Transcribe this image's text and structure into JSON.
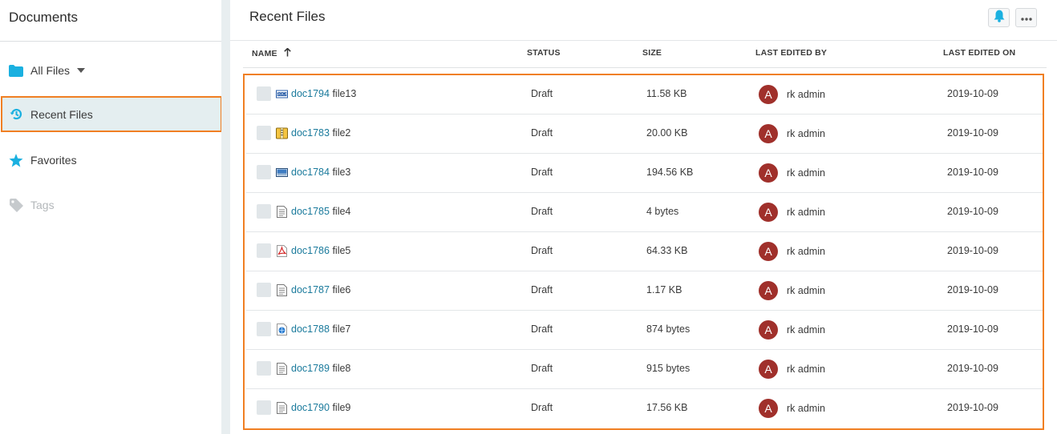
{
  "sidebar": {
    "title": "Documents",
    "items": [
      {
        "label": "All Files"
      },
      {
        "label": "Recent Files"
      },
      {
        "label": "Favorites"
      },
      {
        "label": "Tags"
      }
    ]
  },
  "header": {
    "title": "Recent Files"
  },
  "columns": {
    "name": "NAME",
    "status": "STATUS",
    "size": "SIZE",
    "last_edited_by": "LAST EDITED BY",
    "last_edited_on": "LAST EDITED ON"
  },
  "rows": [
    {
      "doc": "doc1794",
      "file": "file13",
      "icon": "docx-icon",
      "status": "Draft",
      "size": "11.58 KB",
      "avatar": "A",
      "editor": "rk admin",
      "date": "2019-10-09"
    },
    {
      "doc": "doc1783",
      "file": "file2",
      "icon": "archive-icon",
      "status": "Draft",
      "size": "20.00 KB",
      "avatar": "A",
      "editor": "rk admin",
      "date": "2019-10-09"
    },
    {
      "doc": "doc1784",
      "file": "file3",
      "icon": "image-icon",
      "status": "Draft",
      "size": "194.56 KB",
      "avatar": "A",
      "editor": "rk admin",
      "date": "2019-10-09"
    },
    {
      "doc": "doc1785",
      "file": "file4",
      "icon": "text-file-icon",
      "status": "Draft",
      "size": "4 bytes",
      "avatar": "A",
      "editor": "rk admin",
      "date": "2019-10-09"
    },
    {
      "doc": "doc1786",
      "file": "file5",
      "icon": "pdf-icon",
      "status": "Draft",
      "size": "64.33 KB",
      "avatar": "A",
      "editor": "rk admin",
      "date": "2019-10-09"
    },
    {
      "doc": "doc1787",
      "file": "file6",
      "icon": "text-file-icon",
      "status": "Draft",
      "size": "1.17 KB",
      "avatar": "A",
      "editor": "rk admin",
      "date": "2019-10-09"
    },
    {
      "doc": "doc1788",
      "file": "file7",
      "icon": "web-file-icon",
      "status": "Draft",
      "size": "874 bytes",
      "avatar": "A",
      "editor": "rk admin",
      "date": "2019-10-09"
    },
    {
      "doc": "doc1789",
      "file": "file8",
      "icon": "text-file-icon",
      "status": "Draft",
      "size": "915 bytes",
      "avatar": "A",
      "editor": "rk admin",
      "date": "2019-10-09"
    },
    {
      "doc": "doc1790",
      "file": "file9",
      "icon": "text-file-icon",
      "status": "Draft",
      "size": "17.56 KB",
      "avatar": "A",
      "editor": "rk admin",
      "date": "2019-10-09"
    }
  ],
  "colors": {
    "accent": "#1ab0e0",
    "link": "#1a7a9c",
    "highlight_border": "#f07f23",
    "avatar_bg": "#a0302b"
  }
}
